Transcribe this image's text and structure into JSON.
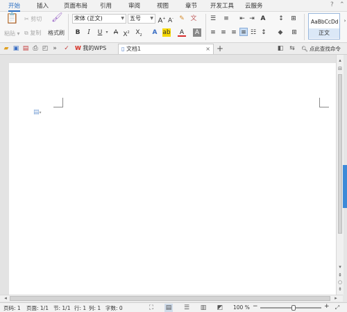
{
  "menu": {
    "tabs": [
      {
        "label": "开始"
      },
      {
        "label": "插入"
      },
      {
        "label": "页面布局"
      },
      {
        "label": "引用"
      },
      {
        "label": "审阅"
      },
      {
        "label": "视图"
      },
      {
        "label": "章节"
      },
      {
        "label": "开发工具"
      },
      {
        "label": "云服务"
      }
    ],
    "active": "开始"
  },
  "ribbon": {
    "paste_label": "粘贴",
    "cut_label": "剪切",
    "copy_label": "复制",
    "format_painter_label": "格式刷",
    "font_name": "宋体 (正文)",
    "font_size": "五号",
    "grow_font": "A",
    "shrink_font": "A",
    "bold": "B",
    "italic": "I",
    "underline": "U",
    "strikethrough": "A",
    "superscript": "X",
    "subscript": "X",
    "style_preview": "AaBbCcDd",
    "style_name": "正文"
  },
  "tabs": {
    "wps_label": "我的WPS",
    "doc_label": "文档1",
    "close_symbol": "×",
    "add_symbol": "+",
    "search_label": "点此查找命令"
  },
  "status": {
    "page_num": "页码: 1",
    "pages": "页面: 1/1",
    "section": "节: 1/1",
    "row": "行: 1",
    "col": "列: 1",
    "words": "字数: 0",
    "zoom": "100 %",
    "zoom_minus": "−",
    "zoom_plus": "+",
    "zoom_level": 0.55
  },
  "colors": {
    "accent": "#2b6fc2",
    "font_color": "#d62a2a",
    "highlight": "#f5d800",
    "wps_logo": "#d6281b"
  }
}
